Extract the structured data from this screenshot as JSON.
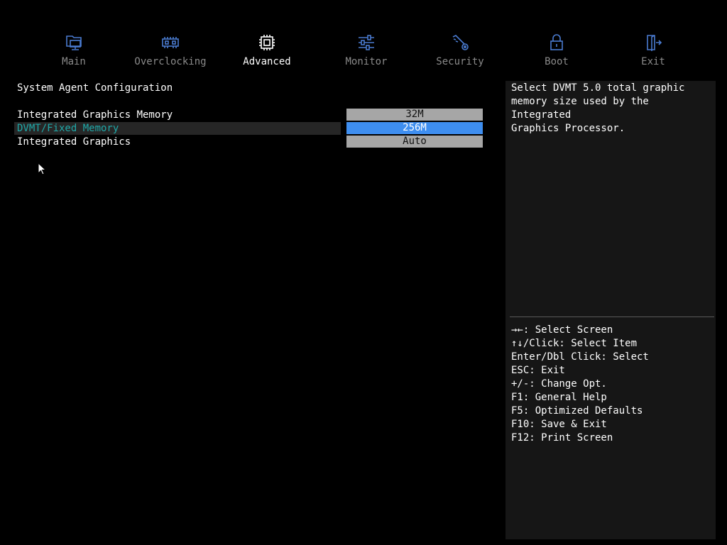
{
  "nav": {
    "tabs": [
      {
        "label": "Main",
        "icon": "computer-icon",
        "active": false
      },
      {
        "label": "Overclocking",
        "icon": "memory-module-icon",
        "active": false
      },
      {
        "label": "Advanced",
        "icon": "chip-icon",
        "active": true
      },
      {
        "label": "Monitor",
        "icon": "sliders-icon",
        "active": false
      },
      {
        "label": "Security",
        "icon": "key-icon",
        "active": false
      },
      {
        "label": "Boot",
        "icon": "lock-icon",
        "active": false
      },
      {
        "label": "Exit",
        "icon": "door-exit-icon",
        "active": false
      }
    ],
    "icon_color": "#4a7bd0"
  },
  "main": {
    "section_title": "System Agent Configuration",
    "settings": [
      {
        "label": "Integrated Graphics Memory",
        "value": "32M",
        "selected": false
      },
      {
        "label": "DVMT/Fixed Memory",
        "value": "256M",
        "selected": true
      },
      {
        "label": "Integrated Graphics",
        "value": "Auto",
        "selected": false
      }
    ]
  },
  "help": {
    "description": "Select DVMT 5.0 total graphic\nmemory size used by the Integrated\nGraphics Processor.",
    "keys": [
      "→←: Select Screen",
      "↑↓/Click: Select Item",
      "Enter/Dbl Click: Select",
      "ESC: Exit",
      "+/-: Change Opt.",
      "F1: General Help",
      "F5: Optimized Defaults",
      "F10: Save & Exit",
      "F12: Print Screen"
    ]
  },
  "colors": {
    "background": "#000000",
    "selected_label": "#1fa8a8",
    "selected_value_bg": "#3e8ef0",
    "value_bg": "#a6a6a6",
    "help_panel_bg": "#161616"
  }
}
